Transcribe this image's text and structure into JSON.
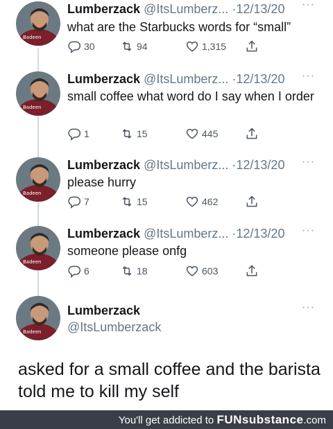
{
  "tweets": [
    {
      "name": "Lumberzack",
      "handle": "@ItsLumberz...",
      "date": "·12/13/20",
      "text": "what are the Starbucks words for “small”",
      "replies": "30",
      "retweets": "94",
      "likes": "1,315"
    },
    {
      "name": "Lumberzack",
      "handle": "@ItsLumberz...",
      "date": "·12/13/20",
      "text": "small coffee what word do I say when I order",
      "replies": "1",
      "retweets": "15",
      "likes": "445"
    },
    {
      "name": "Lumberzack",
      "handle": "@ItsLumberz...",
      "date": "·12/13/20",
      "text": "please hurry",
      "replies": "7",
      "retweets": "15",
      "likes": "462"
    },
    {
      "name": "Lumberzack",
      "handle": "@ItsLumberz...",
      "date": "·12/13/20",
      "text": "someone please onfg",
      "replies": "6",
      "retweets": "18",
      "likes": "603"
    }
  ],
  "final_tweet": {
    "name": "Lumberzack",
    "handle": "@ItsLumberzack",
    "text": "asked for a small coffee and the barista told me to kill my self"
  },
  "more_label": "···",
  "footer": {
    "prefix": "You'll get addicted to ",
    "brand": "FUNsubstance",
    "suffix": ".com"
  },
  "icons": {
    "reply": "reply-icon",
    "retweet": "retweet-icon",
    "like": "heart-icon",
    "share": "share-icon"
  },
  "colors": {
    "text": "#14171a",
    "muted": "#657786",
    "footer_bg": "#3a3f47"
  }
}
